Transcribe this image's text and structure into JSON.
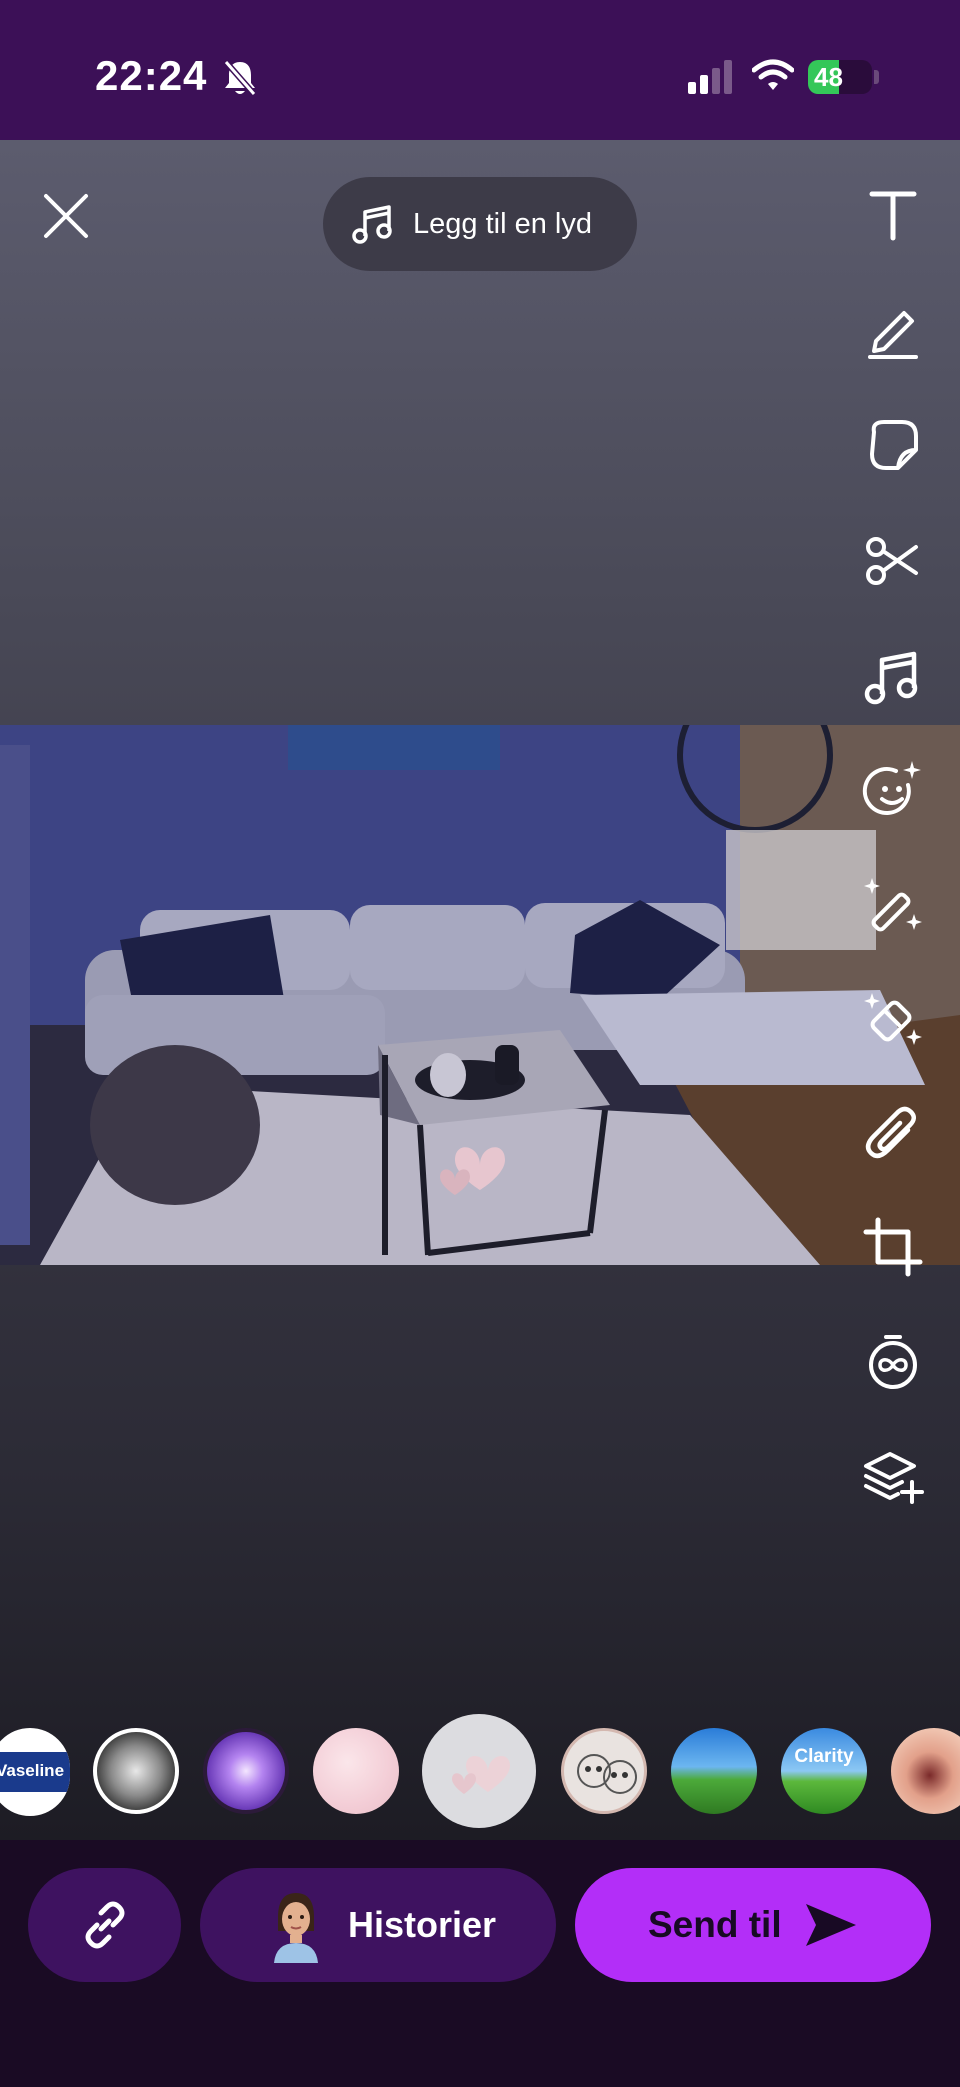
{
  "status_bar": {
    "time": "22:24",
    "battery_percent": "48",
    "icons": [
      "bell-muted-icon",
      "cellular-signal-icon",
      "wifi-icon",
      "battery-charging-icon"
    ]
  },
  "editor": {
    "close_icon": "close-icon",
    "sound_button_label": "Legg til en lyd",
    "tools": [
      "text-tool",
      "draw-tool",
      "sticker-tool",
      "scissors-tool",
      "music-tool",
      "emoji-sparkle-tool",
      "magic-wand-tool",
      "eraser-sparkle-tool",
      "attachment-tool",
      "crop-tool",
      "timer-loop-tool",
      "layer-add-tool"
    ]
  },
  "lenses": [
    {
      "name": "vaseline-lens",
      "label": "Vaseline"
    },
    {
      "name": "flower-lens",
      "label": ""
    },
    {
      "name": "purple-glow-lens",
      "label": ""
    },
    {
      "name": "pink-glitter-lens",
      "label": ""
    },
    {
      "name": "hearts-lens-selected",
      "label": ""
    },
    {
      "name": "sketch-faces-lens",
      "label": ""
    },
    {
      "name": "landscape-lens",
      "label": ""
    },
    {
      "name": "clarity-lens",
      "label": "Clarity"
    },
    {
      "name": "scream-face-lens",
      "label": ""
    }
  ],
  "bottom_bar": {
    "link_icon": "link-icon",
    "stories_label": "Historier",
    "send_label": "Send til"
  },
  "colors": {
    "status_bar_bg": "#3c1057",
    "send_button": "#b32ef8",
    "secondary_button": "#3e1260",
    "battery_green": "#34c759"
  }
}
